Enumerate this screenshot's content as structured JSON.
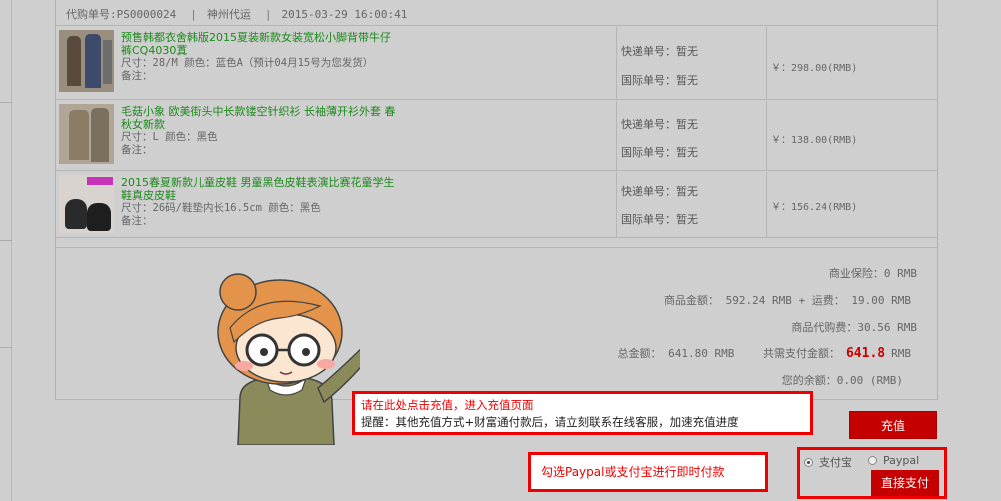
{
  "order": {
    "number_label": "代购单号:PS0000024",
    "agent": "神州代运",
    "datetime": "2015-03-29 16:00:41"
  },
  "items": [
    {
      "title": "预售韩都衣舍韩版2015夏装新款女装宽松小脚背带牛仔裤CQ4030蒖",
      "spec": "尺寸：28/M    颜色：蓝色A（预计04月15号为您发货）",
      "note": "备注：",
      "express": "快递单号：暂无",
      "intl": "国际单号：暂无",
      "price": "￥：298.00(RMB)"
    },
    {
      "title": "毛菇小象 欧美街头中长款镂空针织衫 长袖薄开衫外套 春秋女新款",
      "spec": "尺寸：L    颜色：黑色",
      "note": "备注：",
      "express": "快递单号：暂无",
      "intl": "国际单号：暂无",
      "price": "￥：138.00(RMB)"
    },
    {
      "title": "2015春夏新款儿童皮鞋 男童黑色皮鞋表演比赛花童学生鞋真皮皮鞋",
      "spec": "尺寸：26码/鞋垫内长16.5cm    颜色：黑色",
      "note": "备注：",
      "express": "快递单号：暂无",
      "intl": "国际单号：暂无",
      "price": "￥：156.24(RMB)"
    }
  ],
  "summary": {
    "insurance": "商业保险：0 RMB",
    "goods_and_freight": "商品金额： 592.24 RMB + 运费： 19.00 RMB",
    "agent_fee": "商品代购费：30.56 RMB",
    "total": "总金额： 641.80 RMB",
    "need_pay_label": "共需支付金额：",
    "need_pay_amount": "641.8",
    "need_pay_unit": "RMB",
    "balance": "您的余额：0.00 (RMB)"
  },
  "callout_recharge": {
    "line1": "请在此处点击充值，进入充值页面",
    "line2": "提醒：其他充值方式+财富通付款后，请立刻联系在线客服，加速充值进度"
  },
  "recharge_button": "充值",
  "callout_pay": "勾选Paypal或支付宝进行即时付款",
  "payment": {
    "option_alipay": "支付宝",
    "option_paypal": "Paypal",
    "pay_button": "直接支付"
  },
  "colors": {
    "accent_red": "#c40000",
    "title_green": "#1a8a1a",
    "background": "#cfcfcf"
  }
}
